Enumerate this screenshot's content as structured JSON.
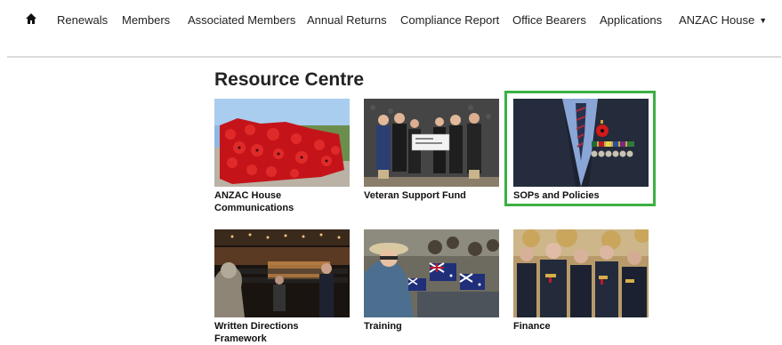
{
  "nav": {
    "home_icon": "home-icon",
    "items": [
      {
        "label": "Renewals"
      },
      {
        "label": "Members"
      },
      {
        "label": "Associated Members"
      },
      {
        "label": "Annual Returns"
      },
      {
        "label": "Compliance Report"
      },
      {
        "label": "Office Bearers"
      },
      {
        "label": "Applications"
      },
      {
        "label": "ANZAC House",
        "dropdown": true
      }
    ]
  },
  "page": {
    "title": "Resource Centre"
  },
  "tiles": [
    {
      "label": "ANZAC House Communications"
    },
    {
      "label": "Veteran Support Fund"
    },
    {
      "label": "SOPs and Policies",
      "highlighted": true
    },
    {
      "label": "Written Directions Framework"
    },
    {
      "label": "Training"
    },
    {
      "label": "Finance"
    }
  ],
  "colors": {
    "highlight": "#3cb043",
    "divider": "#dcdcdc"
  }
}
